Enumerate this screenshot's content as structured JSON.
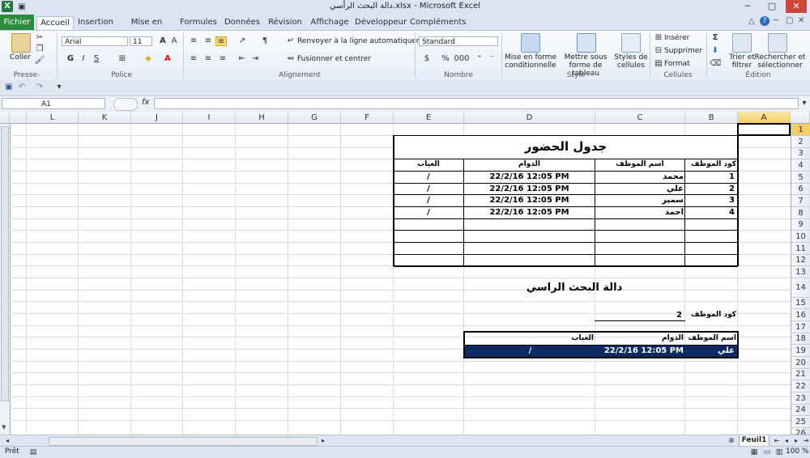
{
  "window": {
    "title": "دالة البحث الرأسي.xlsx - Microsoft Excel",
    "app_icon": "X"
  },
  "tabs": [
    "Fichier",
    "Accueil",
    "Insertion",
    "Mise en page",
    "Formules",
    "Données",
    "Révision",
    "Affichage",
    "Développeur",
    "Compléments"
  ],
  "ribbon": {
    "clipboard": {
      "paste": "Coller",
      "label": "Presse-papiers"
    },
    "font": {
      "name": "Arial",
      "size": "11",
      "bold": "G",
      "italic": "I",
      "underline": "S",
      "label": "Police"
    },
    "alignment": {
      "wrap": "Renvoyer à la ligne automatiquement",
      "merge": "Fusionner et centrer",
      "label": "Alignement"
    },
    "number": {
      "format": "Standard",
      "percent": "%",
      "thousands": "000",
      "label": "Nombre"
    },
    "styles": {
      "cond": "Mise en forme conditionnelle",
      "table": "Mettre sous forme de tableau",
      "cellstyles": "Styles de cellules",
      "label": "Style"
    },
    "cells": {
      "insert": "Insérer",
      "delete": "Supprimer",
      "format": "Format",
      "label": "Cellules"
    },
    "editing": {
      "sort": "Trier et filtrer",
      "find": "Rechercher et sélectionner",
      "label": "Édition"
    }
  },
  "formula_bar": {
    "name_box": "A1",
    "fx": "fx",
    "value": ""
  },
  "columns": [
    "L",
    "K",
    "J",
    "I",
    "H",
    "G",
    "F",
    "E",
    "D",
    "C",
    "B",
    "A"
  ],
  "rows": [
    "1",
    "2",
    "3",
    "4",
    "5",
    "6",
    "7",
    "8",
    "9",
    "10",
    "11",
    "12",
    "13",
    "14",
    "15",
    "16",
    "17",
    "18",
    "19",
    "20",
    "21",
    "22",
    "23",
    "24",
    "25",
    "26"
  ],
  "sheet": {
    "table_title": "جدول الحضور",
    "headers": {
      "code": "كود الموظف",
      "name": "اسم الموظف",
      "time": "الدوام",
      "absence": "الغياب"
    },
    "records": [
      {
        "code": "1",
        "name": "محمد",
        "time": "22/2/16 12:05 PM",
        "absence": "/"
      },
      {
        "code": "2",
        "name": "علي",
        "time": "22/2/16 12:05 PM",
        "absence": "/"
      },
      {
        "code": "3",
        "name": "سمير",
        "time": "22/2/16 12:05 PM",
        "absence": "/"
      },
      {
        "code": "4",
        "name": "أحمد",
        "time": "22/2/16 12:05 PM",
        "absence": "/"
      }
    ],
    "lookup_title": "دالة البحث الراسي",
    "lookup_code_label": "كود الموظف",
    "lookup_code_value": "2",
    "result_headers": {
      "name": "اسم الموظف",
      "time": "الدوام",
      "absence": "الغياب"
    },
    "result": {
      "name": "علي",
      "time": "22/2/16 12:05 PM",
      "absence": "/"
    }
  },
  "sheet_tab": "Feuil1",
  "status": {
    "ready": "Prêt",
    "zoom": "100 %"
  },
  "colors": {
    "accent": "#2d8a3e",
    "result_row": "#0f2a63",
    "selected_header": "#f3cf6a"
  }
}
